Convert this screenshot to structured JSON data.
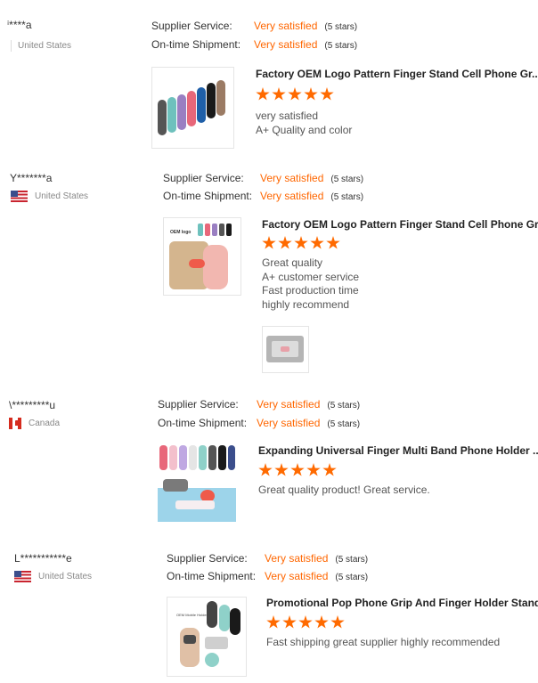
{
  "labels": {
    "supplier_service": "Supplier Service:",
    "ontime_shipment": "On-time Shipment:",
    "very_satisfied": "Very satisfied",
    "five_stars": "(5 stars)"
  },
  "reviews": [
    {
      "buyer": "ⁱ****a",
      "country": "United States",
      "product_title": "Factory OEM Logo Pattern Finger Stand Cell Phone Gr...",
      "comment": [
        "very satisfied",
        "A+ Quality and color"
      ]
    },
    {
      "buyer": "Y*******a",
      "country": "United States",
      "product_title": "Factory OEM Logo Pattern Finger Stand Cell Phone Gr...",
      "comment": [
        "Great quality",
        "A+ customer service",
        "Fast production time",
        "highly recommend"
      ],
      "thumb_label": "OEM logo"
    },
    {
      "buyer": "\\*********u",
      "country": "Canada",
      "product_title": "Expanding Universal Finger Multi Band Phone Holder ...",
      "comment": [
        "Great quality product! Great service."
      ]
    },
    {
      "buyer": "L***********e",
      "country": "United States",
      "product_title": "Promotional Pop Phone Grip And Finger Holder Stand ...",
      "comment": [
        "Fast shipping great supplier highly recommended"
      ],
      "thumb_label": "OEM Mobile Holder"
    }
  ],
  "logo_text": "logo",
  "colors": {
    "accent": "#ff6a00",
    "value": "#ff6600"
  }
}
